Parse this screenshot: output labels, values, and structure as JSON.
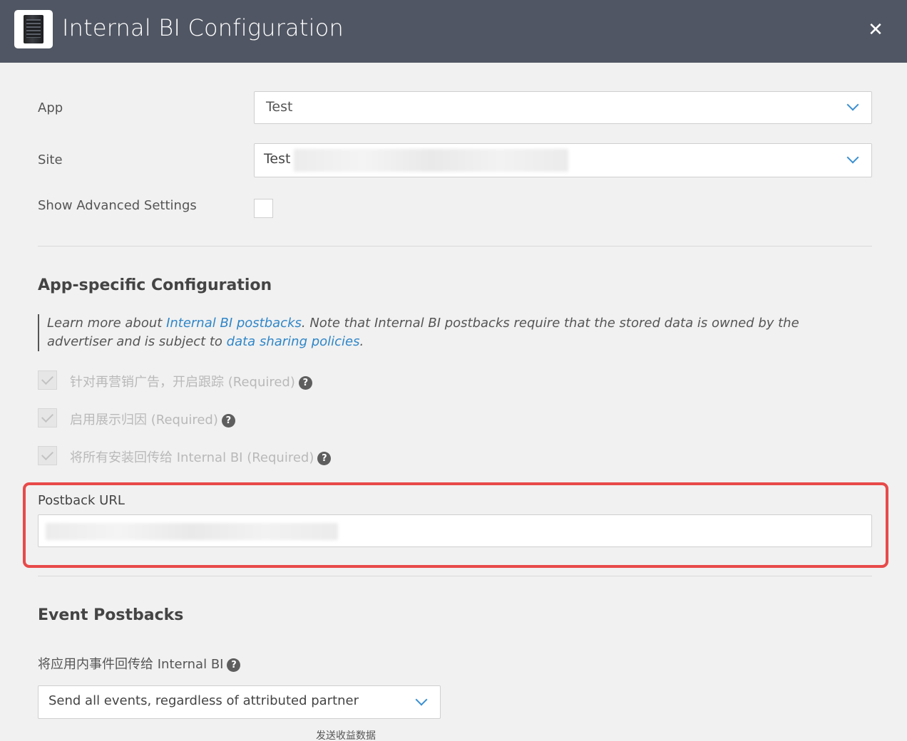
{
  "header": {
    "title": "Internal BI Configuration",
    "close_label": "✕"
  },
  "form": {
    "app_label": "App",
    "app_value": "Test",
    "site_label": "Site",
    "site_value": "Test",
    "advanced_label": "Show Advanced Settings"
  },
  "app_config": {
    "title": "App-specific Configuration",
    "note_prefix": "Learn more about ",
    "note_link1": "Internal BI postbacks",
    "note_middle": ". Note that Internal BI postbacks require that the stored data is owned by the advertiser and is subject to ",
    "note_link2": "data sharing policies",
    "note_suffix": ".",
    "checks": [
      {
        "label": "针对再营销广告，开启跟踪 (Required)",
        "checked": true,
        "disabled": true
      },
      {
        "label": "启用展示归因 (Required)",
        "checked": true,
        "disabled": true
      },
      {
        "label": "将所有安装回传给 Internal BI (Required)",
        "checked": true,
        "disabled": true
      }
    ],
    "help_glyph": "?"
  },
  "postback": {
    "label": "Postback URL",
    "highlight_color": "#e84a4a"
  },
  "event_postbacks": {
    "title": "Event Postbacks",
    "send_label": "将应用内事件回传给 Internal BI",
    "send_value": "Send all events, regardless of attributed partner",
    "revenue_label": "发送收益数据"
  },
  "colors": {
    "header_bg": "#505663",
    "link": "#2f86c8",
    "accent": "#3a8fd1"
  }
}
